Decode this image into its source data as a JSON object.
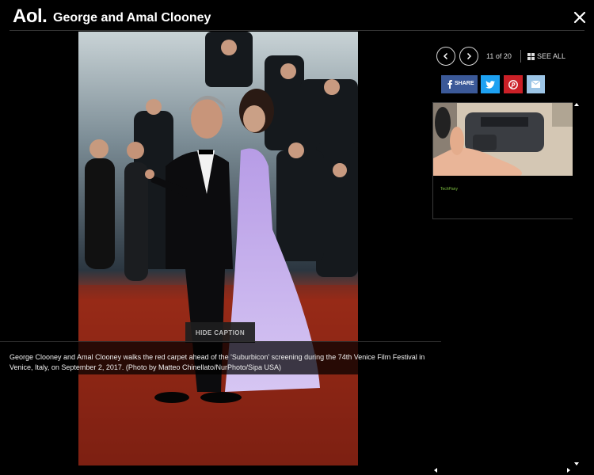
{
  "header": {
    "logo": "Aol.",
    "title": "George and Amal Clooney",
    "close_icon": "close-icon"
  },
  "gallery": {
    "counter": "11 of 20",
    "see_all": "SEE ALL",
    "prev_icon": "chevron-left-icon",
    "next_icon": "chevron-right-icon",
    "grid_icon": "grid-icon"
  },
  "share": {
    "facebook_label": "SHARE",
    "facebook_color": "#3b5998",
    "twitter_color": "#1da1f2",
    "pinterest_color": "#cb2027",
    "mail_color": "#9cc5e6"
  },
  "photo": {
    "hide_caption": "HIDE CAPTION",
    "caption": "George Clooney and Amal Clooney walks the red carpet ahead of the 'Suburbicon' screening during the 74th Venice Film Festival in Venice, Italy, on September 2, 2017. (Photo by Matteo Chinellato/NurPhoto/Sipa USA)"
  },
  "ad": {
    "brand": "TechPany"
  }
}
